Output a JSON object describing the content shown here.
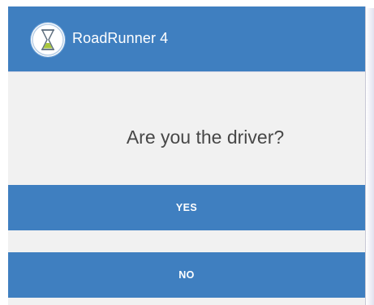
{
  "app_bar": {
    "title": "RoadRunner 4",
    "logo_icon": "hourglass-icon",
    "color": "#3f7fc0"
  },
  "dialog": {
    "question": "Are you the driver?",
    "yes_label": "YES",
    "no_label": "NO"
  }
}
